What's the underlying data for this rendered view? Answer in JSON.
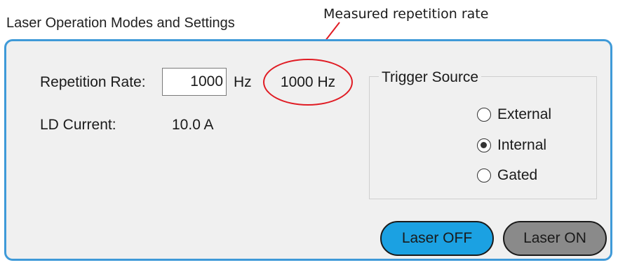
{
  "section_title": "Laser Operation Modes and Settings",
  "annotation": {
    "text": "Measured repetition rate",
    "color": "#e01c24"
  },
  "settings": {
    "repetition_rate_label": "Repetition Rate:",
    "repetition_rate_value": "1000",
    "repetition_rate_unit": "Hz",
    "measured_rate": "1000 Hz",
    "ld_current_label": "LD Current:",
    "ld_current_value": "10.0  A"
  },
  "trigger_source": {
    "title": "Trigger Source",
    "options": [
      {
        "label": "External",
        "selected": false
      },
      {
        "label": "Internal",
        "selected": true
      },
      {
        "label": "Gated",
        "selected": false
      }
    ]
  },
  "buttons": {
    "laser_off": "Laser OFF",
    "laser_on": "Laser ON",
    "laser_off_color": "#1ba1e2",
    "laser_on_color": "#8a8a8a"
  },
  "colors": {
    "panel_border": "#3f9ad8",
    "panel_background": "#f0f0f0"
  }
}
